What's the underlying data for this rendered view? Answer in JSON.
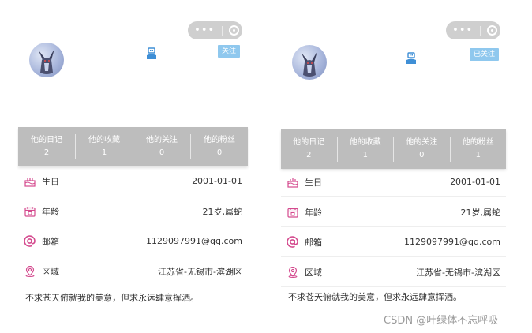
{
  "colors": {
    "stats_bg": "#bdbdbd",
    "follow_bg": "#8fc8ee",
    "icon_pink": "#d44a8e",
    "gender_blue": "#3f8fd6",
    "capsule": "#cfcfcf"
  },
  "capsule": {
    "more_glyph": "•••"
  },
  "panels": [
    {
      "follow_label": "关注",
      "stats": [
        {
          "label": "他的日记",
          "count": "2"
        },
        {
          "label": "他的收藏",
          "count": "1"
        },
        {
          "label": "他的关注",
          "count": "0"
        },
        {
          "label": "他的粉丝",
          "count": "0"
        }
      ],
      "info": [
        {
          "icon": "cake-icon",
          "label": "生日",
          "value": "2001-01-01"
        },
        {
          "icon": "calendar-icon",
          "label": "年龄",
          "value": "21岁,属蛇"
        },
        {
          "icon": "at-icon",
          "label": "邮箱",
          "value": "1129097991@qq.com"
        },
        {
          "icon": "location-icon",
          "label": "区域",
          "value": "江苏省-无锡市-滨湖区"
        }
      ],
      "motto": "不求苍天俯就我的美意，但求永远肆意挥洒。"
    },
    {
      "follow_label": "已关注",
      "stats": [
        {
          "label": "他的日记",
          "count": "2"
        },
        {
          "label": "他的收藏",
          "count": "1"
        },
        {
          "label": "他的关注",
          "count": "0"
        },
        {
          "label": "他的粉丝",
          "count": "1"
        }
      ],
      "info": [
        {
          "icon": "cake-icon",
          "label": "生日",
          "value": "2001-01-01"
        },
        {
          "icon": "calendar-icon",
          "label": "年龄",
          "value": "21岁,属蛇"
        },
        {
          "icon": "at-icon",
          "label": "邮箱",
          "value": "1129097991@qq.com"
        },
        {
          "icon": "location-icon",
          "label": "区域",
          "value": "江苏省-无锡市-滨湖区"
        }
      ],
      "motto": "不求苍天俯就我的美意，但求永远肆意挥洒。"
    }
  ],
  "watermark": "CSDN @叶绿体不忘呼吸"
}
